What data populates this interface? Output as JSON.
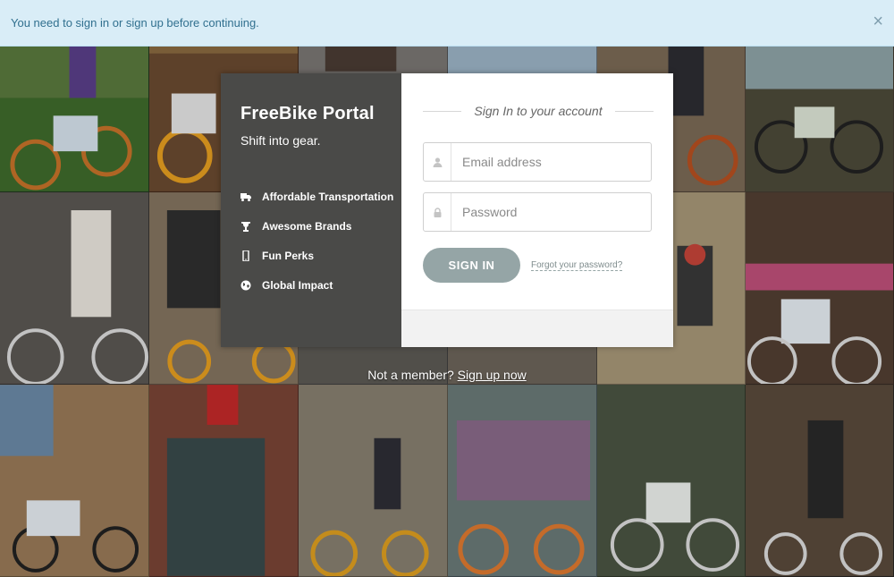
{
  "alert": {
    "message": "You need to sign in or sign up before continuing.",
    "close_glyph": "×"
  },
  "brand": {
    "title": "FreeBike Portal",
    "tagline": "Shift into gear."
  },
  "features": [
    {
      "icon": "truck-icon",
      "label": "Affordable Transportation"
    },
    {
      "icon": "trophy-icon",
      "label": "Awesome Brands"
    },
    {
      "icon": "mobile-icon",
      "label": "Fun Perks"
    },
    {
      "icon": "globe-icon",
      "label": "Global Impact"
    }
  ],
  "login": {
    "heading": "Sign In to your account",
    "email_placeholder": "Email address",
    "password_placeholder": "Password",
    "submit_label": "SIGN IN",
    "forgot_label": "Forgot your password?"
  },
  "signup": {
    "prompt": "Not a member?",
    "link_label": "Sign up now"
  },
  "colors": {
    "alert_bg": "#d9edf7",
    "alert_text": "#31708f",
    "panel_dark": "#4a4a48",
    "button": "#95a5a6"
  }
}
